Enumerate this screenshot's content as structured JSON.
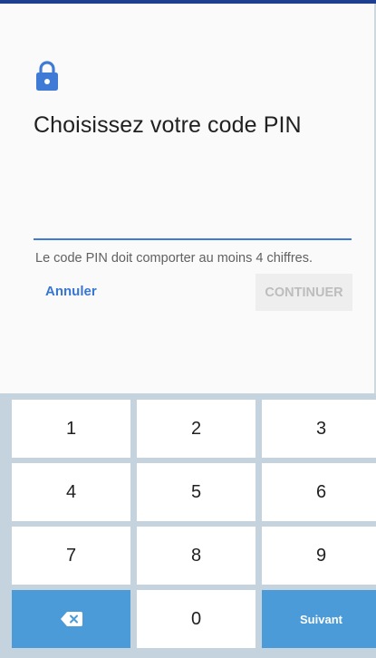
{
  "screen": {
    "title": "Choisissez votre code PIN",
    "hint": "Le code PIN doit comporter au moins 4 chiffres.",
    "pin_value": "",
    "cancel_label": "Annuler",
    "continue_label": "CONTINUER",
    "accent_color": "#3876d2",
    "lock_icon": "lock-icon"
  },
  "keypad": {
    "keys": [
      "1",
      "2",
      "3",
      "4",
      "5",
      "6",
      "7",
      "8",
      "9",
      "",
      "0",
      "Suivant"
    ],
    "backspace_icon": "backspace-icon",
    "accent_color": "#4a9bd8"
  }
}
